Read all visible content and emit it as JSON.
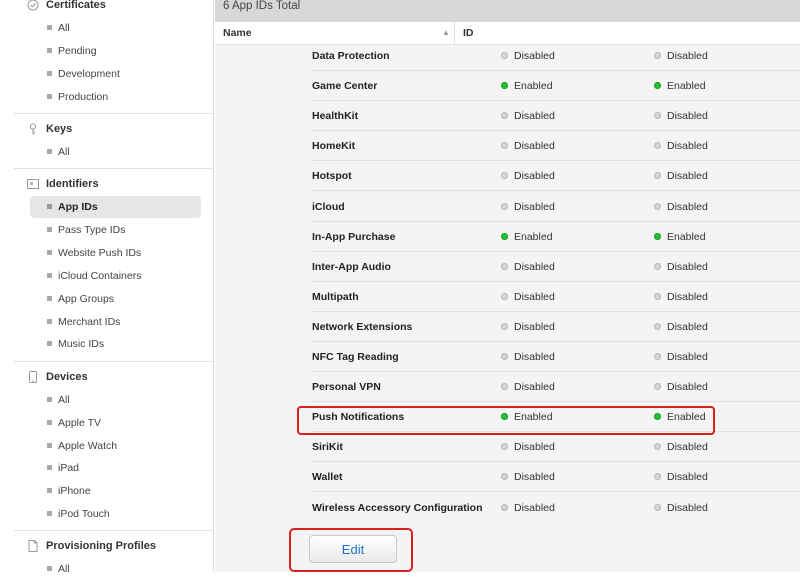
{
  "sidebar": {
    "sections": [
      {
        "label": "Certificates",
        "icon": "certificate-icon",
        "items": [
          {
            "label": "All"
          },
          {
            "label": "Pending"
          },
          {
            "label": "Development"
          },
          {
            "label": "Production"
          }
        ]
      },
      {
        "label": "Keys",
        "icon": "key-icon",
        "items": [
          {
            "label": "All"
          }
        ]
      },
      {
        "label": "Identifiers",
        "icon": "id-card-icon",
        "items": [
          {
            "label": "App IDs",
            "active": true
          },
          {
            "label": "Pass Type IDs"
          },
          {
            "label": "Website Push IDs"
          },
          {
            "label": "iCloud Containers"
          },
          {
            "label": "App Groups"
          },
          {
            "label": "Merchant IDs"
          },
          {
            "label": "Music IDs"
          }
        ]
      },
      {
        "label": "Devices",
        "icon": "device-icon",
        "items": [
          {
            "label": "All"
          },
          {
            "label": "Apple TV"
          },
          {
            "label": "Apple Watch"
          },
          {
            "label": "iPad"
          },
          {
            "label": "iPhone"
          },
          {
            "label": "iPod Touch"
          }
        ]
      },
      {
        "label": "Provisioning Profiles",
        "icon": "document-icon",
        "items": [
          {
            "label": "All"
          }
        ]
      }
    ]
  },
  "main": {
    "total_label": "6 App IDs Total",
    "columns": {
      "name": "Name",
      "id": "ID"
    },
    "capabilities": [
      {
        "name": "Data Protection",
        "dev": "Disabled",
        "dist": "Disabled"
      },
      {
        "name": "Game Center",
        "dev": "Enabled",
        "dist": "Enabled"
      },
      {
        "name": "HealthKit",
        "dev": "Disabled",
        "dist": "Disabled"
      },
      {
        "name": "HomeKit",
        "dev": "Disabled",
        "dist": "Disabled"
      },
      {
        "name": "Hotspot",
        "dev": "Disabled",
        "dist": "Disabled"
      },
      {
        "name": "iCloud",
        "dev": "Disabled",
        "dist": "Disabled"
      },
      {
        "name": "In-App Purchase",
        "dev": "Enabled",
        "dist": "Enabled"
      },
      {
        "name": "Inter-App Audio",
        "dev": "Disabled",
        "dist": "Disabled"
      },
      {
        "name": "Multipath",
        "dev": "Disabled",
        "dist": "Disabled"
      },
      {
        "name": "Network Extensions",
        "dev": "Disabled",
        "dist": "Disabled"
      },
      {
        "name": "NFC Tag Reading",
        "dev": "Disabled",
        "dist": "Disabled"
      },
      {
        "name": "Personal VPN",
        "dev": "Disabled",
        "dist": "Disabled"
      },
      {
        "name": "Push Notifications",
        "dev": "Enabled",
        "dist": "Enabled"
      },
      {
        "name": "SiriKit",
        "dev": "Disabled",
        "dist": "Disabled"
      },
      {
        "name": "Wallet",
        "dev": "Disabled",
        "dist": "Disabled"
      },
      {
        "name": "Wireless Accessory Configuration",
        "dev": "Disabled",
        "dist": "Disabled"
      }
    ],
    "edit_label": "Edit"
  },
  "colors": {
    "enabled": "#25c035",
    "disabled": "#d6d6d6",
    "highlight": "#d8201f",
    "link": "#1d70c7"
  }
}
